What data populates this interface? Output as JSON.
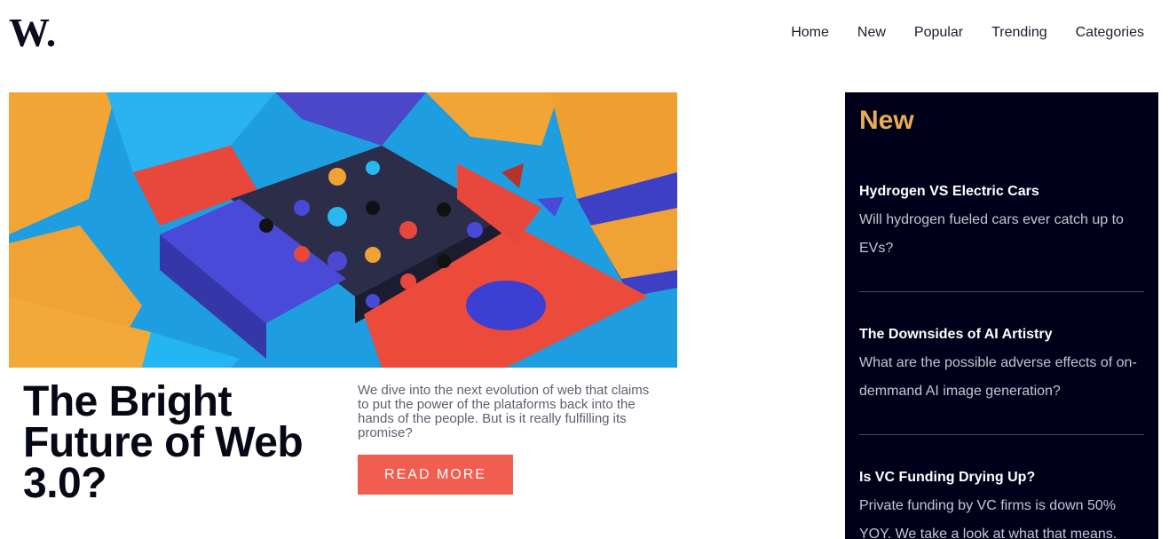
{
  "brand": {
    "logo_text": "W."
  },
  "nav": {
    "items": [
      {
        "label": "Home"
      },
      {
        "label": "New"
      },
      {
        "label": "Popular"
      },
      {
        "label": "Trending"
      },
      {
        "label": "Categories"
      }
    ]
  },
  "article": {
    "headline": "The Bright Future of Web 3.0?",
    "excerpt": "We dive into the next evolution of web that claims to put the power of the plataforms back into the hands of the people. But is it really fulfilling its promise?",
    "cta_label": "READ MORE"
  },
  "sidebar": {
    "title": "New",
    "items": [
      {
        "title": "Hydrogen VS Electric Cars",
        "description": "Will hydrogen fueled cars ever catch up to EVs?"
      },
      {
        "title": "The Downsides of AI Artistry",
        "description": "What are the possible adverse effects of on-demmand AI image generation?"
      },
      {
        "title": "Is VC Funding Drying Up?",
        "description": "Private funding by VC firms is down 50% YOY. We take a look at what that means."
      }
    ]
  },
  "colors": {
    "accent": "#f15e50",
    "sidebar_bg": "#00001a",
    "sidebar_title": "#e9ab53",
    "text_dark": "#070816",
    "text_muted": "#5d5f71"
  }
}
